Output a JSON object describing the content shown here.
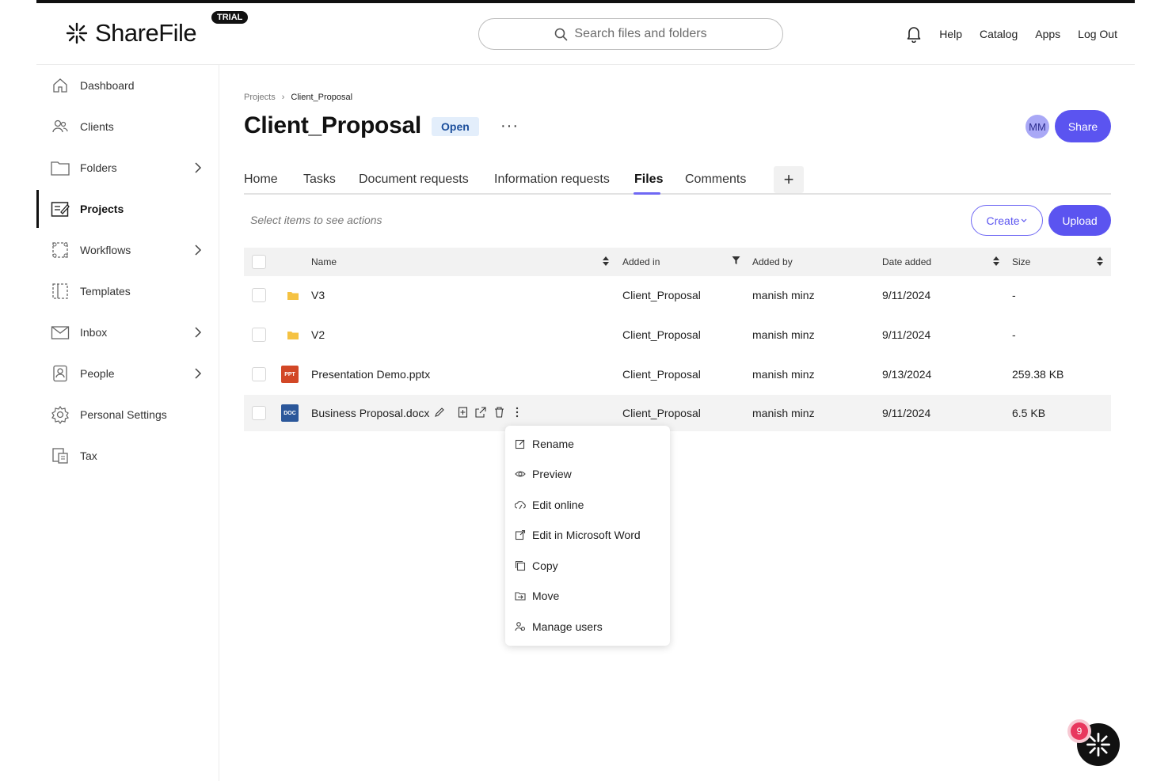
{
  "app": {
    "name": "ShareFile",
    "trial_label": "TRIAL"
  },
  "header": {
    "search_placeholder": "Search files and folders",
    "nav": [
      "Help",
      "Catalog",
      "Apps",
      "Log Out"
    ]
  },
  "sidebar": {
    "items": [
      {
        "label": "Dashboard",
        "icon": "home-icon"
      },
      {
        "label": "Clients",
        "icon": "clients-icon"
      },
      {
        "label": "Folders",
        "icon": "folder-icon"
      },
      {
        "label": "Projects",
        "icon": "projects-icon",
        "active": true
      },
      {
        "label": "Workflows",
        "icon": "workflows-icon"
      },
      {
        "label": "Templates",
        "icon": "templates-icon"
      },
      {
        "label": "Inbox",
        "icon": "inbox-icon"
      },
      {
        "label": "People",
        "icon": "people-icon"
      },
      {
        "label": "Personal Settings",
        "icon": "settings-icon"
      },
      {
        "label": "Tax",
        "icon": "tax-icon"
      }
    ]
  },
  "project": {
    "breadcrumb": [
      "Projects",
      "Client_Proposal"
    ],
    "title": "Client_Proposal",
    "status": "Open",
    "more": "···",
    "avatar_initials": "MM",
    "share_label": "Share"
  },
  "tabs": {
    "items": [
      "Home",
      "Tasks",
      "Document requests",
      "Information requests",
      "Files",
      "Comments"
    ],
    "active": "Files",
    "add": "+"
  },
  "toolbar": {
    "hint": "Select items to see actions",
    "create_label": "Create",
    "upload_label": "Upload"
  },
  "table": {
    "columns": [
      "Name",
      "Added in",
      "Added by",
      "Date added",
      "Size"
    ],
    "rows": [
      {
        "name": "V3",
        "type": "folder",
        "added_in": "Client_Proposal",
        "added_by": "manish minz",
        "date": "9/11/2024",
        "size": "-"
      },
      {
        "name": "V2",
        "type": "folder",
        "added_in": "Client_Proposal",
        "added_by": "manish minz",
        "date": "9/11/2024",
        "size": "-"
      },
      {
        "name": "Presentation Demo.pptx",
        "type": "pptx",
        "type_label": "PPT",
        "added_in": "Client_Proposal",
        "added_by": "manish minz",
        "date": "9/13/2024",
        "size": "259.38 KB"
      },
      {
        "name": "Business Proposal.docx",
        "type": "docx",
        "type_label": "DOC",
        "added_in": "Client_Proposal",
        "added_by": "manish minz",
        "date": "9/11/2024",
        "size": "6.5 KB"
      }
    ]
  },
  "context_menu": {
    "items": [
      "Rename",
      "Preview",
      "Edit online",
      "Edit in Microsoft Word",
      "Copy",
      "Move",
      "Manage users"
    ]
  },
  "assistant": {
    "badge_count": "9"
  },
  "colors": {
    "accent": "#5b54f0",
    "ppt": "#d24726",
    "doc": "#2b579a",
    "folder": "#f5c242"
  }
}
